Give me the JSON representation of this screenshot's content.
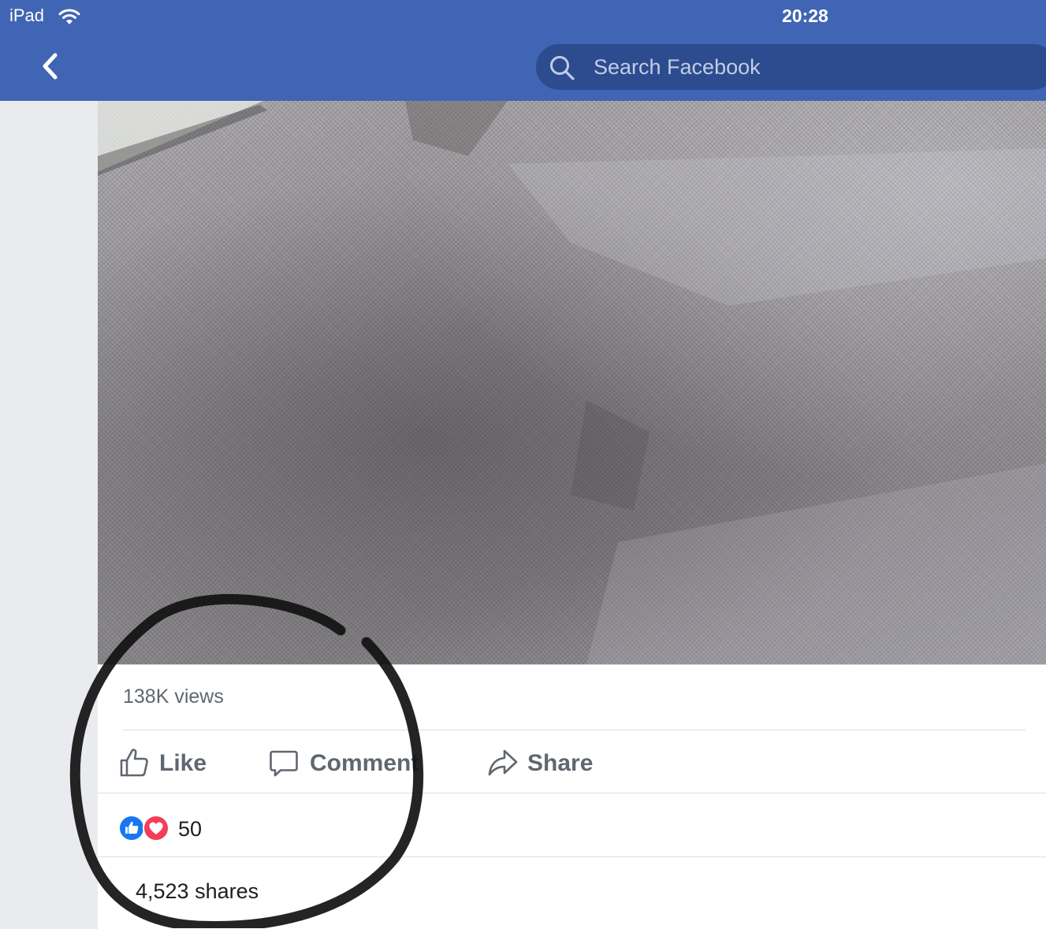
{
  "status_bar": {
    "carrier": "iPad",
    "time": "20:28",
    "wifi_icon": "wifi-icon"
  },
  "navbar": {
    "back_icon": "chevron-left-icon",
    "search": {
      "icon": "search-icon",
      "placeholder": "Search Facebook"
    }
  },
  "post": {
    "media": "video",
    "views": "138K views",
    "actions": [
      {
        "label": "Like",
        "icon": "thumbs-up-icon"
      },
      {
        "label": "Comment",
        "icon": "comment-bubble-icon"
      },
      {
        "label": "Share",
        "icon": "share-arrow-icon"
      }
    ],
    "reactions": {
      "icons": [
        "like-reaction-icon",
        "love-reaction-icon"
      ],
      "count": "50"
    },
    "shares": "4,523 shares"
  },
  "colors": {
    "brand_blue": "#4065b4",
    "search_bg": "#2d4c8f",
    "text_secondary": "#606770",
    "like_blue": "#1877f2",
    "love_red": "#f33e58"
  }
}
